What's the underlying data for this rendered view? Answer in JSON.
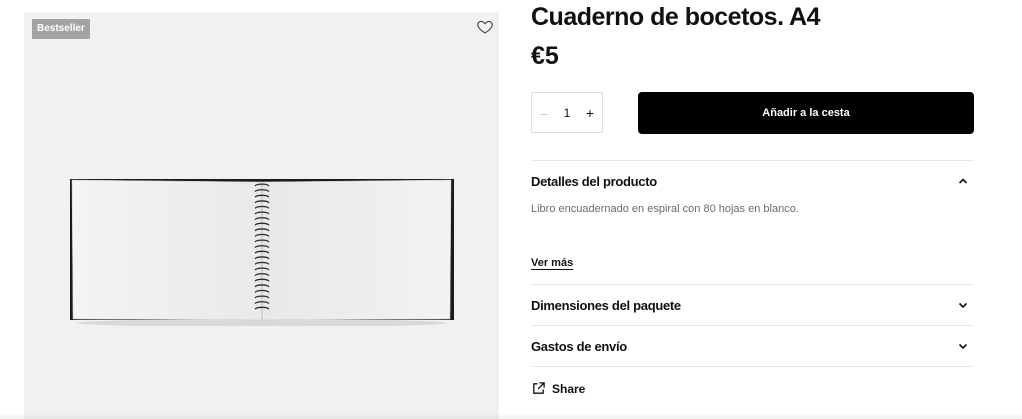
{
  "gallery": {
    "badge": "Bestseller",
    "favorite_icon": "heart-icon",
    "image_alt": "spiral-notebook-open"
  },
  "product": {
    "title": "Cuaderno de bocetos. A4",
    "price": "€5"
  },
  "purchase": {
    "quantity": "1",
    "minus_symbol": "–",
    "plus_symbol": "+",
    "add_to_cart_label": "Añadir a la cesta"
  },
  "accordion": {
    "details": {
      "title": "Detalles del producto",
      "body": "Libro encuadernado en espiral con 80 hojas en blanco.",
      "see_more": "Ver más",
      "expanded": true,
      "icon": "chevron-up-icon"
    },
    "dimensions": {
      "title": "Dimensiones del paquete",
      "expanded": false,
      "icon": "chevron-down-icon"
    },
    "shipping": {
      "title": "Gastos de envío",
      "expanded": false,
      "icon": "chevron-down-icon"
    }
  },
  "share": {
    "label": "Share",
    "icon": "external-link-icon"
  },
  "colors": {
    "button_bg": "#000000",
    "badge_bg": "#a3a3a3",
    "gallery_bg": "#f1f1f1"
  }
}
